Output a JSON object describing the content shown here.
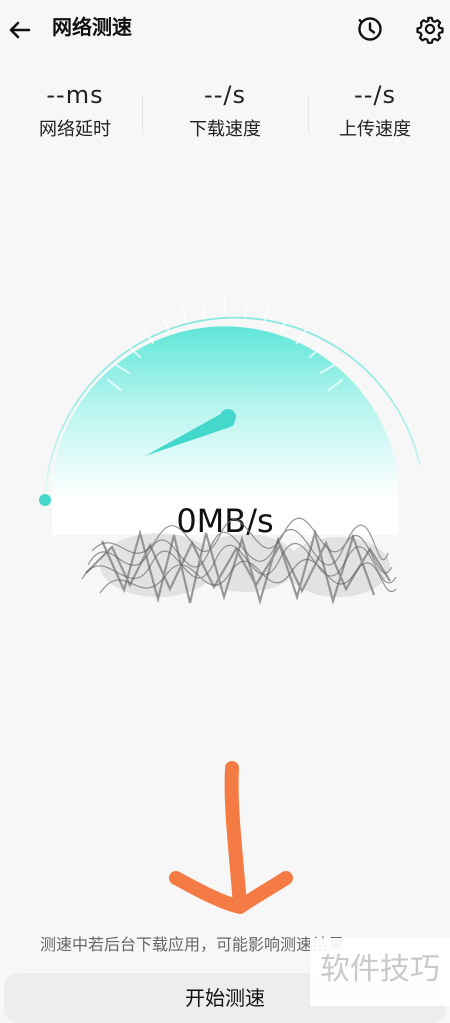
{
  "header": {
    "title": "网络测速",
    "back_icon": "back-arrow-icon",
    "history_icon": "history-icon",
    "settings_icon": "gear-icon"
  },
  "stats": [
    {
      "value": "--ms",
      "label": "网络延时"
    },
    {
      "value": "--/s",
      "label": "下载速度"
    },
    {
      "value": "--/s",
      "label": "上传速度"
    }
  ],
  "gauge": {
    "speed": "0MB/s",
    "needle_fraction": 0.0,
    "accent_color": "#43d8cb",
    "fill_top_color": "#59e5d7",
    "fill_bottom_color": "#ffffff"
  },
  "footer": {
    "hint": "测速中若后台下载应用，可能影响测速结果",
    "start_button": "开始测速"
  },
  "watermark": {
    "text": "软件技巧"
  }
}
